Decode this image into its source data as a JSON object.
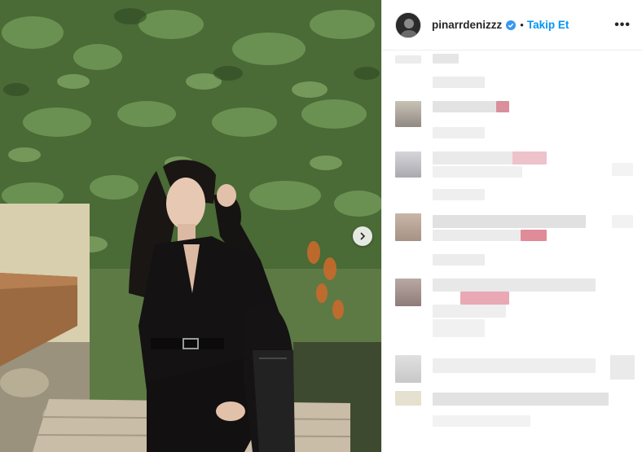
{
  "post": {
    "username": "pinarrdenizzz",
    "separator": "•",
    "follow_label": "Takip Et",
    "more_label": "•••",
    "verified": true
  },
  "colors": {
    "accent": "#0095f6",
    "verified_badge": "#3897f0",
    "blur_gray": "#e6e6e6",
    "blur_pink": "#e9a3b0"
  },
  "icons": {
    "carousel_next": "chevron-right-icon",
    "verified": "verified-badge-icon",
    "more": "ellipsis-icon"
  }
}
